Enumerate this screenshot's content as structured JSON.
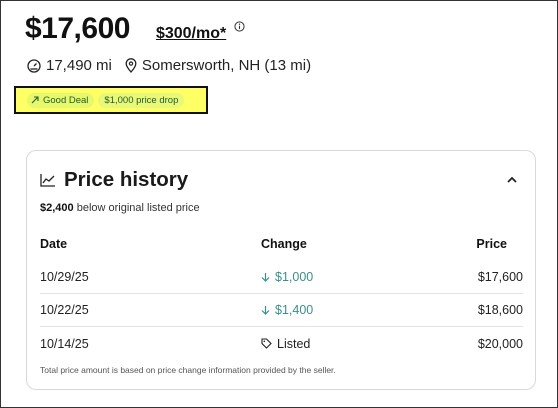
{
  "listing": {
    "price": "$17,600",
    "monthly_payment": "$300/mo*",
    "mileage": "17,490 mi",
    "location": "Somersworth, NH (13 mi)",
    "badges": {
      "deal": "Good Deal",
      "price_drop": "$1,000 price drop"
    }
  },
  "price_history": {
    "title": "Price history",
    "subtitle_amount": "$2,400",
    "subtitle_text": " below original listed price",
    "columns": {
      "date": "Date",
      "change": "Change",
      "price": "Price"
    },
    "rows": [
      {
        "date": "10/29/25",
        "change": "$1,000",
        "change_type": "down",
        "price": "$17,600"
      },
      {
        "date": "10/22/25",
        "change": "$1,400",
        "change_type": "down",
        "price": "$18,600"
      },
      {
        "date": "10/14/25",
        "change": "Listed",
        "change_type": "listed",
        "price": "$20,000"
      }
    ],
    "footnote": "Total price amount is based on price change information provided by the seller."
  },
  "colors": {
    "highlight": "#ffff66",
    "badge_text": "#1f5b34",
    "change_down": "#3a8f8c"
  },
  "icons": [
    "info-icon",
    "speedometer-icon",
    "location-pin-icon",
    "trend-up-icon",
    "line-chart-icon",
    "chevron-up-icon",
    "arrow-down-icon",
    "tag-icon"
  ]
}
